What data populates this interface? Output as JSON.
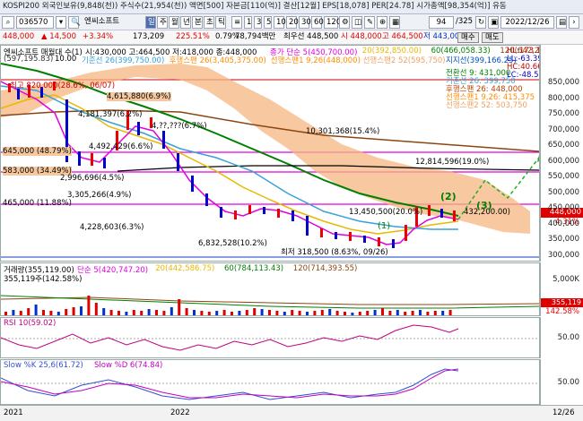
{
  "ticker_text": "KOSPI200 외국인보유(9,848(천)) 주식수(21,954(천)) 액면[500] 자본금[110(억)] 결산[12월] EPS[18,078] PER[24.78] 시가총액[98,354(억)] 유동",
  "toolbar": {
    "code": "036570",
    "name": "엔씨소프트",
    "periods": [
      "일",
      "주",
      "월",
      "년",
      "분",
      "초",
      "틱"
    ],
    "selected_period": "일",
    "intervals": [
      "1",
      "3",
      "5",
      "10",
      "20",
      "30",
      "60",
      "120"
    ],
    "count": "94",
    "total": "/325",
    "date": "2022/12/26"
  },
  "quote": {
    "price": "448,000",
    "change": "▲ 14,500",
    "rate": "+3.34%",
    "volume": "173,209",
    "vol_ratio": "225.51%",
    "turnover_ratio": "0.79%",
    "amount": "78,794백만",
    "best_ask": "최우선 448,500",
    "open": "시 448,000",
    "high": "고 464,500",
    "low": "저 443,000",
    "buy_label": "매수",
    "sell_label": "매도"
  },
  "price_panel": {
    "legend_title": "엔씨소프트 매월대 수(1)",
    "legend_ohlc": "시:430,000 고:464,500 저:418,000 종:448,000",
    "legend_series": [
      {
        "text": "종가 단순 5(450,700.00)",
        "color": "#e000e0"
      },
      {
        "text": "20(392,850.00)",
        "color": "#e8b800"
      },
      {
        "text": "60(466,058.33)",
        "color": "#008000"
      },
      {
        "text": "120(642,287.50)",
        "color": "#8b4513"
      }
    ],
    "legend2": [
      {
        "text": "10.00",
        "color": "#000"
      },
      {
        "text": "기준선 26(399,750.00)",
        "color": "#3aa0d8"
      },
      {
        "text": "후행스팬 26(3,405,375.00)",
        "color": "#ff8c00"
      },
      {
        "text": "선행스팬1 9,26(448,000)",
        "color": "#ff8c00"
      },
      {
        "text": "선행스팬2 52(595,750)",
        "color": "#f0a060"
      },
      {
        "text": "지지선(399,166.25)",
        "color": "#0050c0"
      }
    ],
    "top_left_value": "(597,195.83)",
    "right_info": [
      {
        "text": "HL:173.16",
        "color": "#c00000"
      },
      {
        "text": "LL:-63.39",
        "color": "#0000c0"
      },
      {
        "text": "HC:40.66",
        "color": "#c00000"
      },
      {
        "text": "LC:-48.51",
        "color": "#0000c0"
      }
    ],
    "ichimoku_info": [
      {
        "text": "전환선 9: 431,000",
        "color": "#008000"
      },
      {
        "text": "기준선 26: 399,750",
        "color": "#3aa0d8"
      },
      {
        "text": "후행스팬 26: 448,000",
        "color": "#c04000"
      },
      {
        "text": "선행스팬1 9,26: 415,375",
        "color": "#ff8c00"
      },
      {
        "text": "선행스팬2 52: 503,750",
        "color": "#f0a060"
      }
    ],
    "annotations": [
      {
        "text": "4,615,880(6.9%)"
      },
      {
        "text": "4,181,397(6.2%)"
      },
      {
        "text": "4,492,429(6.6%)"
      },
      {
        "text": "4,??,???(6.7%)"
      },
      {
        "text": "2,996,696(4.5%)"
      },
      {
        "text": "3,305,266(4.9%)"
      },
      {
        "text": "4,228,603(6.3%)"
      },
      {
        "text": "6,832,528(10.2%)"
      },
      {
        "text": "10,301,368(15.4%)"
      },
      {
        "text": "12,814,596(19.0%)"
      },
      {
        "text": "13,450,500(20.0%)"
      },
      {
        "text": "432,200.00)"
      },
      {
        "text": "최저 318,500 (8.63%, 09/26)"
      },
      {
        "text": "최고 820,000(28.6%, 06/07)"
      }
    ],
    "levels": [
      {
        "text": "645,000 (48.79%)"
      },
      {
        "text": "583,000 (34.49%)"
      },
      {
        "text": "465,000 (11.88%)"
      }
    ],
    "wave_labels": [
      "(1)",
      "(2)",
      "(3)"
    ],
    "price_tag": "448,000",
    "price_tag_pct": "4.31%",
    "axis": [
      "850,000",
      "800,000",
      "750,000",
      "700,000",
      "650,000",
      "600,000",
      "550,000",
      "500,000",
      "450,000",
      "400,000",
      "350,000",
      "300,000"
    ]
  },
  "volume_panel": {
    "legend": [
      {
        "text": "거래량(355,119.00)",
        "color": "#000"
      },
      {
        "text": "단순 5(420,747.20)",
        "color": "#e000e0"
      },
      {
        "text": "20(442,586.75)",
        "color": "#e8b800"
      },
      {
        "text": "60(784,113.43)",
        "color": "#008000"
      },
      {
        "text": "120(714,393.55)",
        "color": "#8b4513"
      }
    ],
    "sub": "355,119주(142.58%)",
    "axis": [
      "5,000K",
      "355,119",
      "142.58%"
    ]
  },
  "rsi_panel": {
    "legend": "RSI 10(59.02)",
    "axis": [
      "50.00"
    ]
  },
  "slow_panel": {
    "legend_k": "Slow %K 25,6(61.72)",
    "legend_d": "Slow %D 6(74.84)",
    "axis": [
      "50.00"
    ]
  },
  "x_axis": [
    "2021",
    "2022",
    "12/26"
  ]
}
